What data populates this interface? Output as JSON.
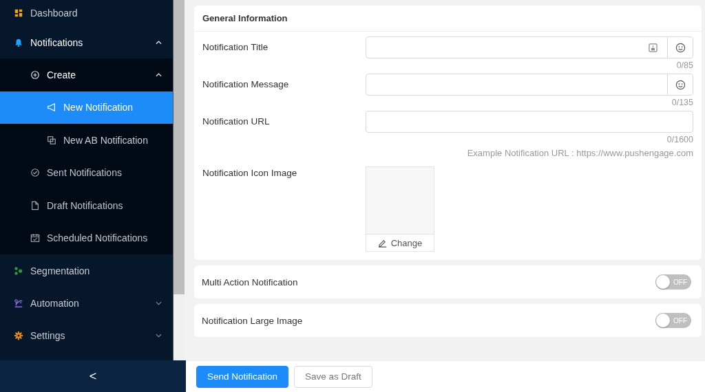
{
  "sidebar": {
    "items": [
      {
        "label": "Dashboard",
        "selected": false
      },
      {
        "label": "Notifications",
        "selected": false,
        "expanded": true,
        "children": [
          {
            "label": "Create",
            "selected": false,
            "expanded": true,
            "children": [
              {
                "label": "New Notification",
                "selected": true
              },
              {
                "label": "New AB Notification",
                "selected": false
              }
            ]
          },
          {
            "label": "Sent Notifications",
            "selected": false
          },
          {
            "label": "Draft Notifications",
            "selected": false
          },
          {
            "label": "Scheduled Notifications",
            "selected": false
          }
        ]
      },
      {
        "label": "Segmentation",
        "selected": false
      },
      {
        "label": "Automation",
        "selected": false,
        "expanded": false
      },
      {
        "label": "Settings",
        "selected": false,
        "expanded": false
      }
    ],
    "collapse": "<"
  },
  "general": {
    "title": "General Information",
    "fields": [
      {
        "kind": "personalized",
        "label": "Notification Title",
        "counter": "0/85"
      },
      {
        "kind": "emoji",
        "label": "Notification Message",
        "counter": "0/135"
      },
      {
        "kind": "plain",
        "label": "Notification URL",
        "counter": "0/1600",
        "hint": "Example Notification URL : https://www.pushengage.com"
      },
      {
        "kind": "image",
        "label": "Notification Icon Image",
        "button": "Change"
      }
    ]
  },
  "toggles": [
    {
      "label": "Multi Action Notification",
      "on": false,
      "state": "OFF"
    },
    {
      "label": "Notification Large Image",
      "on": false,
      "state": "OFF"
    }
  ],
  "buttons": [
    {
      "label": "Send Notification",
      "kind": "primary"
    },
    {
      "label": "Save as Draft",
      "kind": "default"
    }
  ]
}
